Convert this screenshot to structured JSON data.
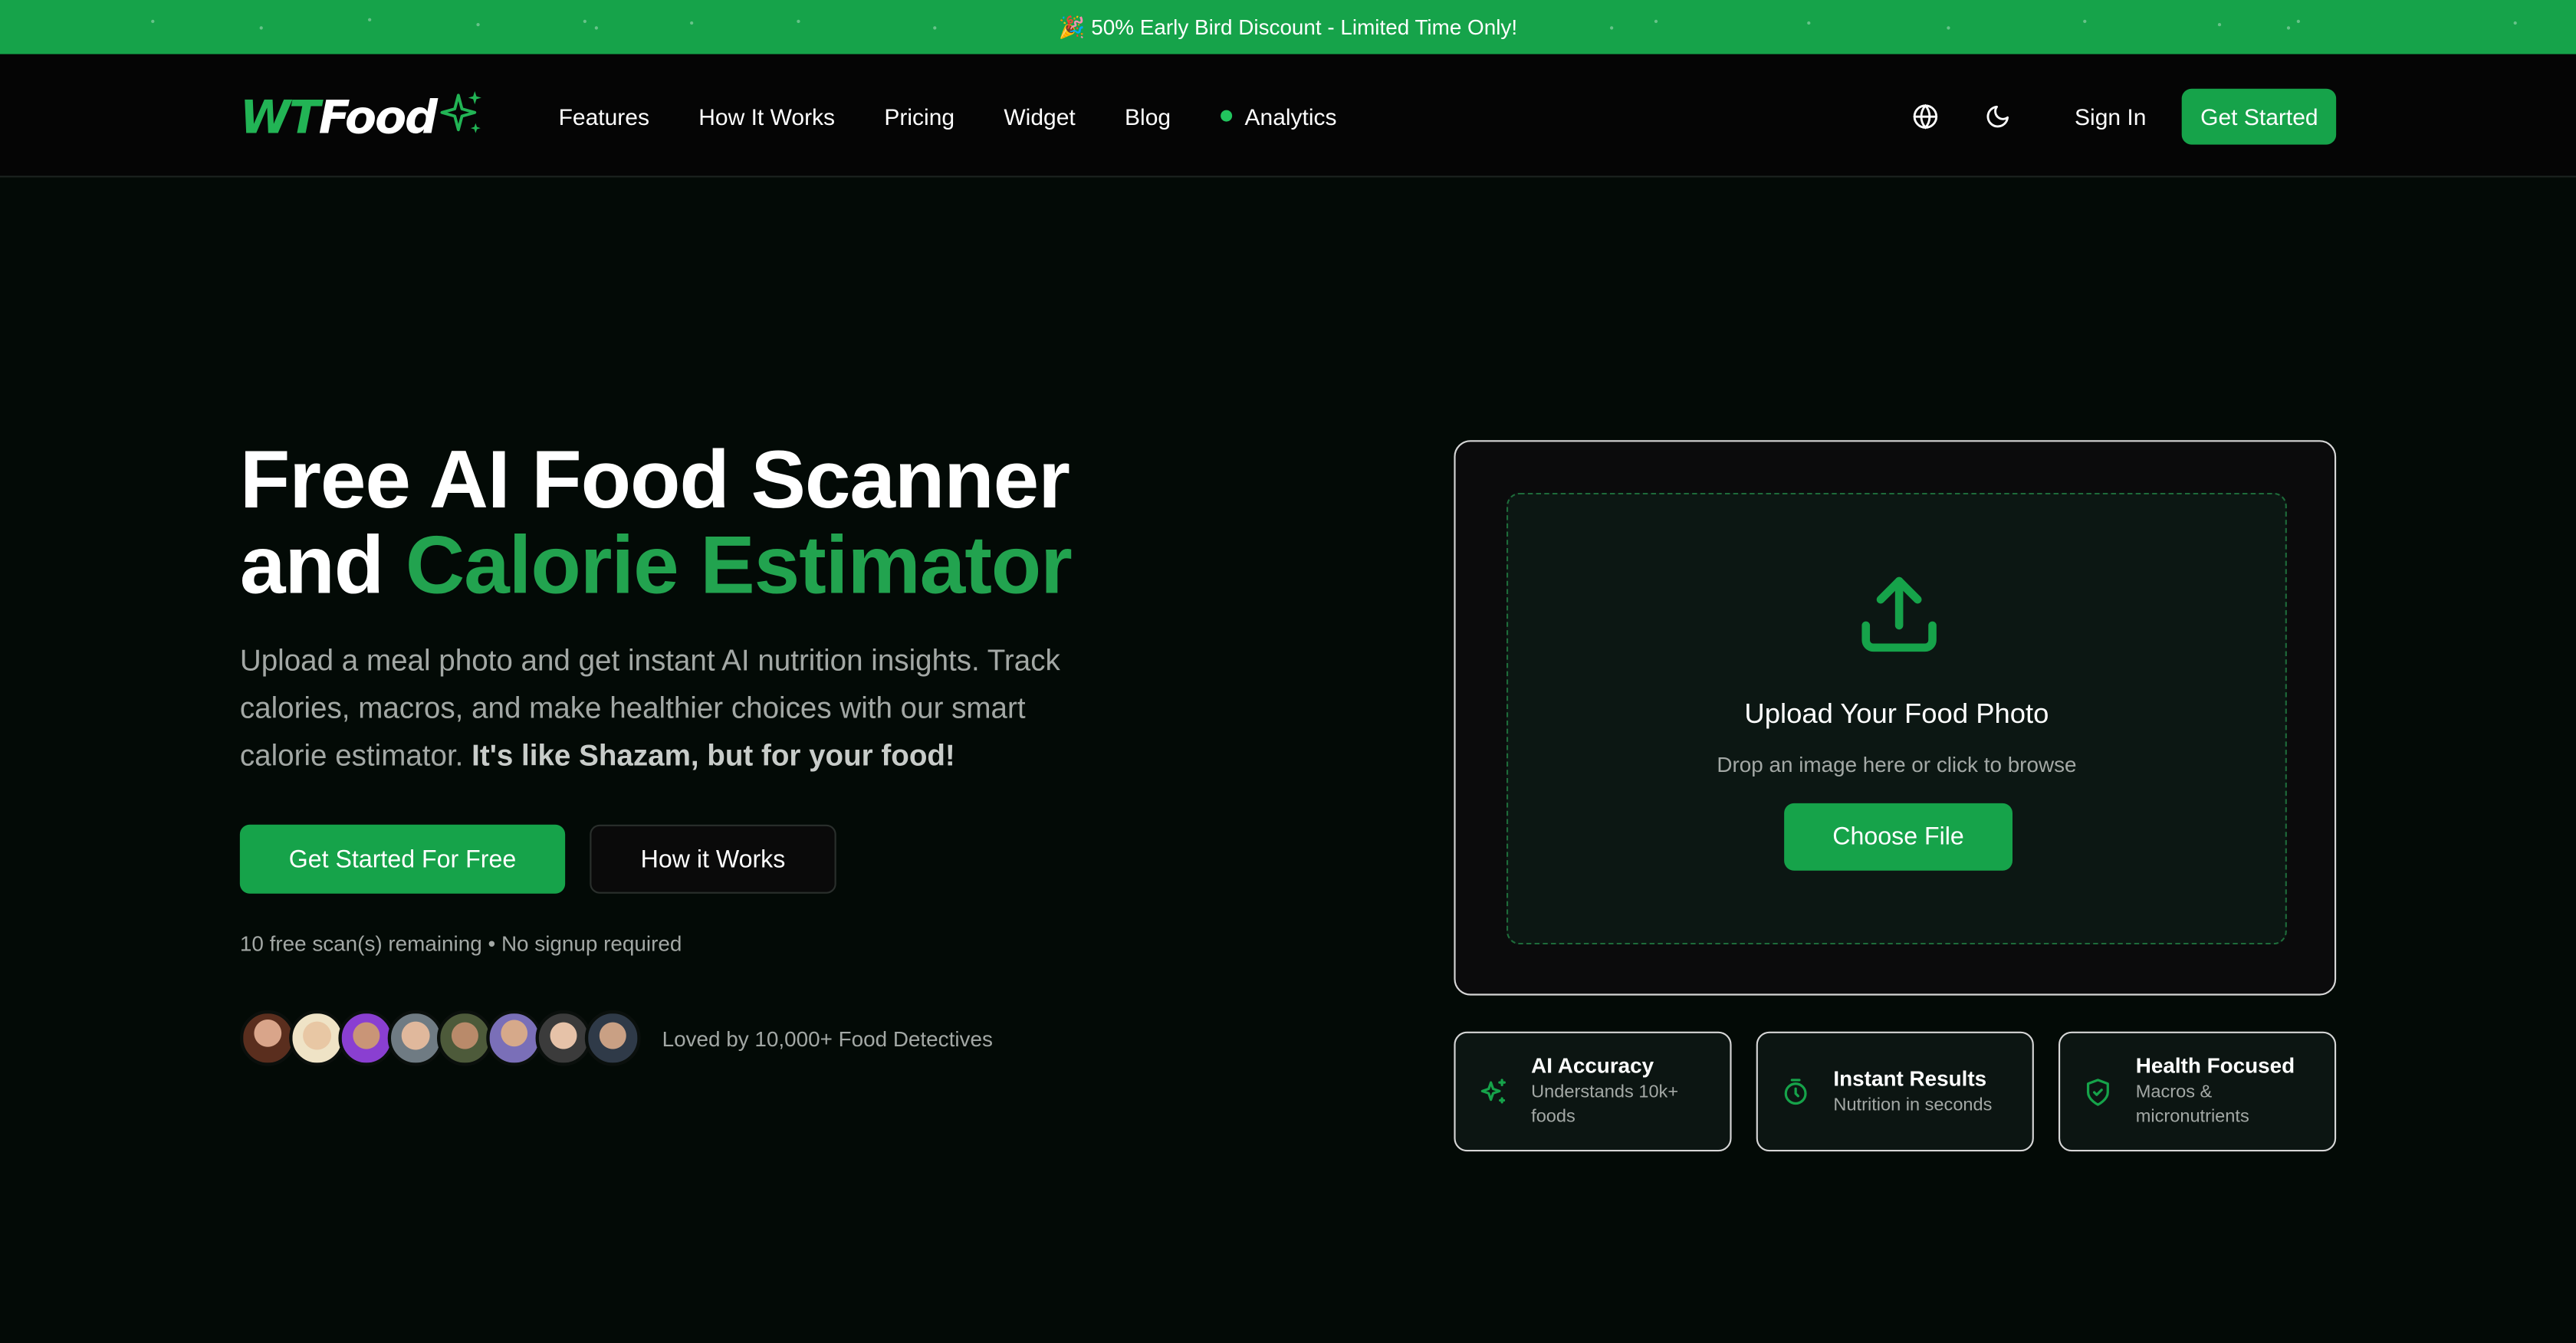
{
  "banner": {
    "text": "🎉 50% Early Bird Discount - Limited Time Only!"
  },
  "brand": {
    "logo_wt": "WT",
    "logo_food": "Food",
    "accent": "#16a34a"
  },
  "nav": {
    "links": [
      {
        "label": "Features"
      },
      {
        "label": "How It Works"
      },
      {
        "label": "Pricing"
      },
      {
        "label": "Widget"
      },
      {
        "label": "Blog"
      },
      {
        "label": "Analytics",
        "live_indicator": true
      }
    ],
    "icons": [
      "globe-icon",
      "moon-icon"
    ],
    "sign_in": "Sign In",
    "cta": "Get Started"
  },
  "hero": {
    "title_line1": "Free AI Food Scanner",
    "title_line2_plain": "and ",
    "title_line2_accent": "Calorie Estimator",
    "subtitle": "Upload a meal photo and get instant AI nutrition insights. Track calories, macros, and make healthier choices with our smart calorie estimator. ",
    "subtitle_bold": "It's like Shazam, but for your food!",
    "primary_button": "Get Started For Free",
    "secondary_button": "How it Works",
    "remaining_note": "10 free scan(s) remaining • No signup required",
    "social_proof": "Loved by 10,000+ Food Detectives",
    "avatar_count": 8
  },
  "upload": {
    "icon": "upload-icon",
    "title": "Upload Your Food Photo",
    "hint": "Drop an image here or click to browse",
    "button": "Choose File"
  },
  "features": [
    {
      "icon": "sparkle-icon",
      "title": "AI Accuracy",
      "desc": "Understands 10k+ foods"
    },
    {
      "icon": "timer-icon",
      "title": "Instant Results",
      "desc": "Nutrition in seconds"
    },
    {
      "icon": "shield-check-icon",
      "title": "Health Focused",
      "desc": "Macros & micronutrients"
    }
  ]
}
